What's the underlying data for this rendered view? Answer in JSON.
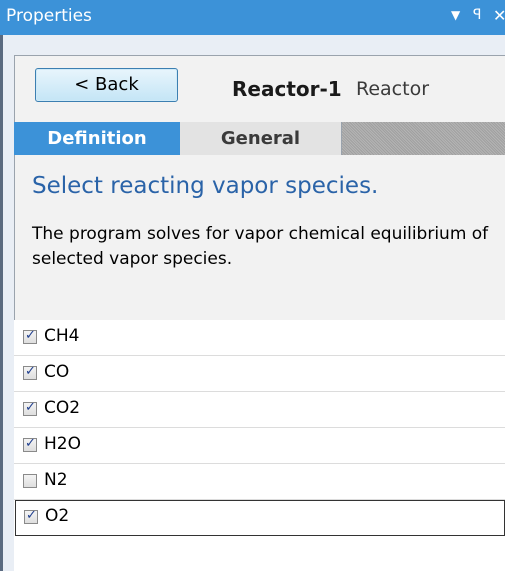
{
  "window": {
    "title": "Properties",
    "menu_icon": "▼",
    "pin_icon": "ꟼ",
    "close_icon": "✕"
  },
  "header": {
    "back_label": "< Back",
    "object_name": "Reactor-1",
    "object_type": "Reactor"
  },
  "tabs": [
    {
      "label": "Definition",
      "active": true
    },
    {
      "label": "General",
      "active": false
    }
  ],
  "main": {
    "heading": "Select reacting vapor species.",
    "description": "The program solves for vapor chemical equilibrium of selected vapor species."
  },
  "species": [
    {
      "label": "CH4",
      "checked": true
    },
    {
      "label": "CO",
      "checked": true
    },
    {
      "label": "CO2",
      "checked": true
    },
    {
      "label": "H2O",
      "checked": true
    },
    {
      "label": "N2",
      "checked": false
    },
    {
      "label": "O2",
      "checked": true
    }
  ],
  "colors": {
    "accent": "#3c92d8",
    "heading": "#2a63a8"
  }
}
